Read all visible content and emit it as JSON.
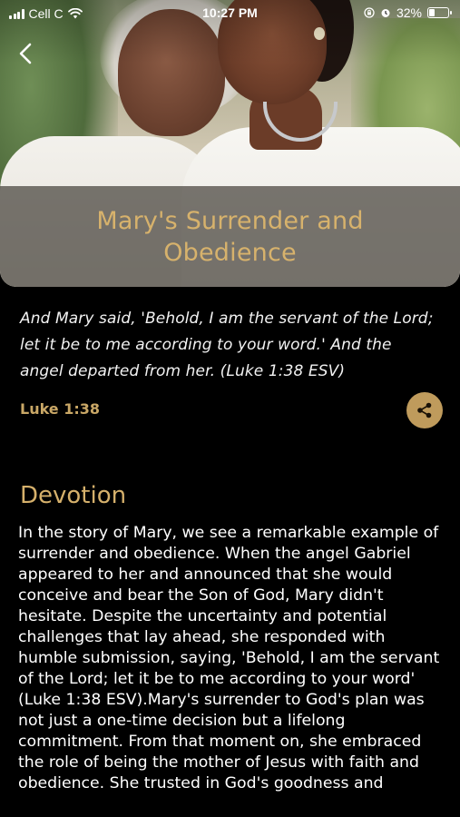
{
  "status": {
    "carrier": "Cell C",
    "time": "10:27 PM",
    "battery": "32%",
    "battery_level": 0.32,
    "icons": [
      "signal-bars-icon",
      "wifi-icon",
      "screen-lock-icon",
      "alarm-icon",
      "battery-icon"
    ]
  },
  "nav": {
    "back_icon": "chevron-left-icon"
  },
  "title": "Mary's Surrender and Obedience",
  "verse": {
    "text": "And Mary said, 'Behold, I am the servant of the Lord; let it be to me according to your word.' And the angel departed from her. (Luke 1:38 ESV)",
    "reference": "Luke 1:38",
    "share_icon": "share-icon"
  },
  "devotion": {
    "heading": "Devotion",
    "body": "In the story of Mary, we see a remarkable example of surrender and obedience. When the angel Gabriel appeared to her and announced that she would conceive and bear the Son of God, Mary didn't hesitate. Despite the uncertainty and potential challenges that lay ahead, she responded with humble submission, saying, 'Behold, I am the servant of the Lord; let it be to me according to your word' (Luke 1:38 ESV).Mary's surrender to God's plan was not just a one-time decision but a lifelong commitment. From that moment on, she embraced the role of being the mother of Jesus with faith and obedience. She trusted in God's goodness and"
  },
  "colors": {
    "accent": "#d5b06b",
    "share_bg": "#bf9b5c",
    "background": "#000000"
  }
}
